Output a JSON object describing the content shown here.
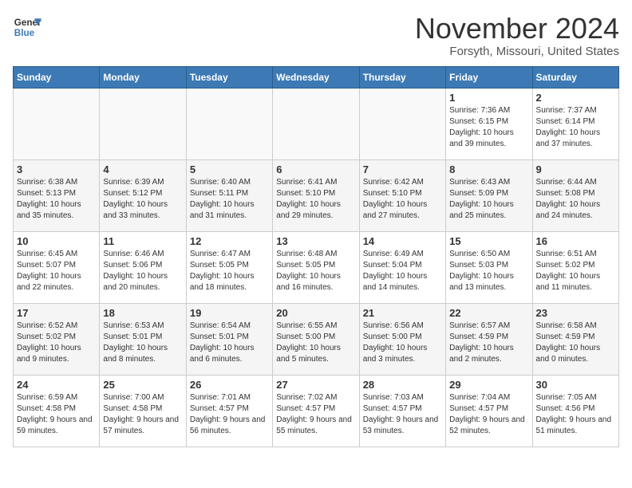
{
  "header": {
    "logo_line1": "General",
    "logo_line2": "Blue",
    "month_title": "November 2024",
    "location": "Forsyth, Missouri, United States"
  },
  "days_of_week": [
    "Sunday",
    "Monday",
    "Tuesday",
    "Wednesday",
    "Thursday",
    "Friday",
    "Saturday"
  ],
  "weeks": [
    [
      {
        "day": "",
        "info": ""
      },
      {
        "day": "",
        "info": ""
      },
      {
        "day": "",
        "info": ""
      },
      {
        "day": "",
        "info": ""
      },
      {
        "day": "",
        "info": ""
      },
      {
        "day": "1",
        "info": "Sunrise: 7:36 AM\nSunset: 6:15 PM\nDaylight: 10 hours and 39 minutes."
      },
      {
        "day": "2",
        "info": "Sunrise: 7:37 AM\nSunset: 6:14 PM\nDaylight: 10 hours and 37 minutes."
      }
    ],
    [
      {
        "day": "3",
        "info": "Sunrise: 6:38 AM\nSunset: 5:13 PM\nDaylight: 10 hours and 35 minutes."
      },
      {
        "day": "4",
        "info": "Sunrise: 6:39 AM\nSunset: 5:12 PM\nDaylight: 10 hours and 33 minutes."
      },
      {
        "day": "5",
        "info": "Sunrise: 6:40 AM\nSunset: 5:11 PM\nDaylight: 10 hours and 31 minutes."
      },
      {
        "day": "6",
        "info": "Sunrise: 6:41 AM\nSunset: 5:10 PM\nDaylight: 10 hours and 29 minutes."
      },
      {
        "day": "7",
        "info": "Sunrise: 6:42 AM\nSunset: 5:10 PM\nDaylight: 10 hours and 27 minutes."
      },
      {
        "day": "8",
        "info": "Sunrise: 6:43 AM\nSunset: 5:09 PM\nDaylight: 10 hours and 25 minutes."
      },
      {
        "day": "9",
        "info": "Sunrise: 6:44 AM\nSunset: 5:08 PM\nDaylight: 10 hours and 24 minutes."
      }
    ],
    [
      {
        "day": "10",
        "info": "Sunrise: 6:45 AM\nSunset: 5:07 PM\nDaylight: 10 hours and 22 minutes."
      },
      {
        "day": "11",
        "info": "Sunrise: 6:46 AM\nSunset: 5:06 PM\nDaylight: 10 hours and 20 minutes."
      },
      {
        "day": "12",
        "info": "Sunrise: 6:47 AM\nSunset: 5:05 PM\nDaylight: 10 hours and 18 minutes."
      },
      {
        "day": "13",
        "info": "Sunrise: 6:48 AM\nSunset: 5:05 PM\nDaylight: 10 hours and 16 minutes."
      },
      {
        "day": "14",
        "info": "Sunrise: 6:49 AM\nSunset: 5:04 PM\nDaylight: 10 hours and 14 minutes."
      },
      {
        "day": "15",
        "info": "Sunrise: 6:50 AM\nSunset: 5:03 PM\nDaylight: 10 hours and 13 minutes."
      },
      {
        "day": "16",
        "info": "Sunrise: 6:51 AM\nSunset: 5:02 PM\nDaylight: 10 hours and 11 minutes."
      }
    ],
    [
      {
        "day": "17",
        "info": "Sunrise: 6:52 AM\nSunset: 5:02 PM\nDaylight: 10 hours and 9 minutes."
      },
      {
        "day": "18",
        "info": "Sunrise: 6:53 AM\nSunset: 5:01 PM\nDaylight: 10 hours and 8 minutes."
      },
      {
        "day": "19",
        "info": "Sunrise: 6:54 AM\nSunset: 5:01 PM\nDaylight: 10 hours and 6 minutes."
      },
      {
        "day": "20",
        "info": "Sunrise: 6:55 AM\nSunset: 5:00 PM\nDaylight: 10 hours and 5 minutes."
      },
      {
        "day": "21",
        "info": "Sunrise: 6:56 AM\nSunset: 5:00 PM\nDaylight: 10 hours and 3 minutes."
      },
      {
        "day": "22",
        "info": "Sunrise: 6:57 AM\nSunset: 4:59 PM\nDaylight: 10 hours and 2 minutes."
      },
      {
        "day": "23",
        "info": "Sunrise: 6:58 AM\nSunset: 4:59 PM\nDaylight: 10 hours and 0 minutes."
      }
    ],
    [
      {
        "day": "24",
        "info": "Sunrise: 6:59 AM\nSunset: 4:58 PM\nDaylight: 9 hours and 59 minutes."
      },
      {
        "day": "25",
        "info": "Sunrise: 7:00 AM\nSunset: 4:58 PM\nDaylight: 9 hours and 57 minutes."
      },
      {
        "day": "26",
        "info": "Sunrise: 7:01 AM\nSunset: 4:57 PM\nDaylight: 9 hours and 56 minutes."
      },
      {
        "day": "27",
        "info": "Sunrise: 7:02 AM\nSunset: 4:57 PM\nDaylight: 9 hours and 55 minutes."
      },
      {
        "day": "28",
        "info": "Sunrise: 7:03 AM\nSunset: 4:57 PM\nDaylight: 9 hours and 53 minutes."
      },
      {
        "day": "29",
        "info": "Sunrise: 7:04 AM\nSunset: 4:57 PM\nDaylight: 9 hours and 52 minutes."
      },
      {
        "day": "30",
        "info": "Sunrise: 7:05 AM\nSunset: 4:56 PM\nDaylight: 9 hours and 51 minutes."
      }
    ]
  ]
}
